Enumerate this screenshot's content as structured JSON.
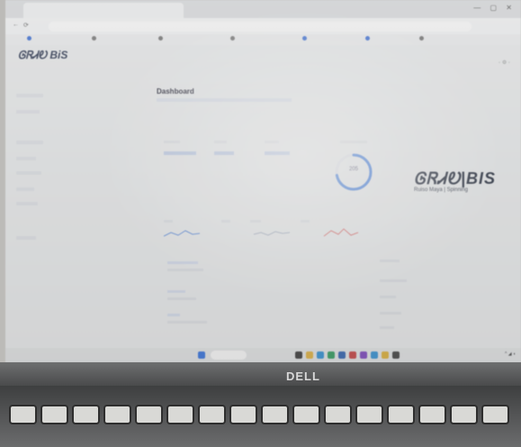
{
  "app": {
    "logo_text": "ᎶᏒᏗᎧ BiS",
    "brand_main": "ᎶᏒᏗᎧ|BIS",
    "brand_sub": "Ruiso Maya | Spinning"
  },
  "dashboard": {
    "title": "Dashboard",
    "subtitle": "",
    "gauge_value": "205",
    "gauge_fraction": 0.72
  },
  "laptop": {
    "brand": "DELL"
  },
  "colors": {
    "accent": "#3f7de0",
    "spark_red": "#e07070",
    "spark_blue": "#5b8be0"
  }
}
